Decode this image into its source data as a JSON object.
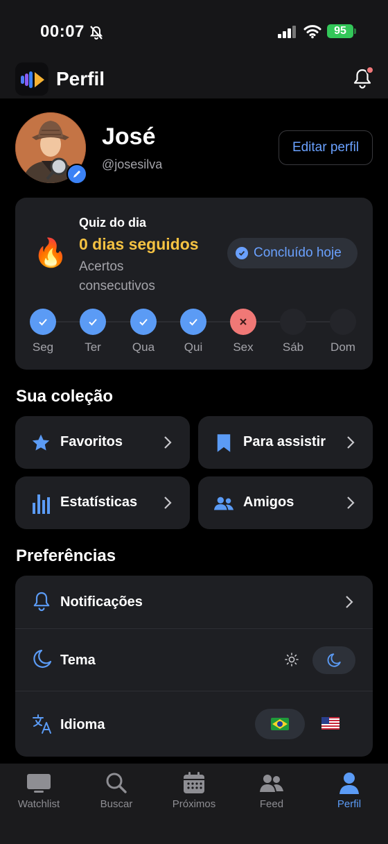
{
  "status_bar": {
    "time": "00:07",
    "battery": "95"
  },
  "header": {
    "title": "Perfil"
  },
  "profile": {
    "name": "José",
    "handle": "@josesilva",
    "edit_label": "Editar perfil"
  },
  "quiz": {
    "title": "Quiz do dia",
    "streak": "0 dias seguidos",
    "subtitle": "Acertos consecutivos",
    "done_label": "Concluído hoje",
    "days": [
      {
        "label": "Seg",
        "state": "ok"
      },
      {
        "label": "Ter",
        "state": "ok"
      },
      {
        "label": "Qua",
        "state": "ok"
      },
      {
        "label": "Qui",
        "state": "ok"
      },
      {
        "label": "Sex",
        "state": "fail"
      },
      {
        "label": "Sáb",
        "state": "none"
      },
      {
        "label": "Dom",
        "state": "none"
      }
    ]
  },
  "collection": {
    "title": "Sua coleção",
    "items": [
      {
        "label": "Favoritos",
        "icon": "star-icon"
      },
      {
        "label": "Para assistir",
        "icon": "bookmark-icon"
      },
      {
        "label": "Estatísticas",
        "icon": "bar-chart-icon"
      },
      {
        "label": "Amigos",
        "icon": "friends-icon"
      }
    ]
  },
  "preferences": {
    "title": "Preferências",
    "notifications": "Notificações",
    "theme": "Tema",
    "theme_selected": "dark",
    "language": "Idioma",
    "language_selected": "pt-BR"
  },
  "tabs": [
    {
      "label": "Watchlist",
      "icon": "tv-icon"
    },
    {
      "label": "Buscar",
      "icon": "search-icon"
    },
    {
      "label": "Próximos",
      "icon": "calendar-icon"
    },
    {
      "label": "Feed",
      "icon": "people-icon"
    },
    {
      "label": "Perfil",
      "icon": "person-icon",
      "active": true
    }
  ],
  "colors": {
    "accent": "#5b9bf5",
    "streak": "#f5c242",
    "fail": "#f07876",
    "card": "#1e1f23",
    "battery": "#33c759"
  }
}
